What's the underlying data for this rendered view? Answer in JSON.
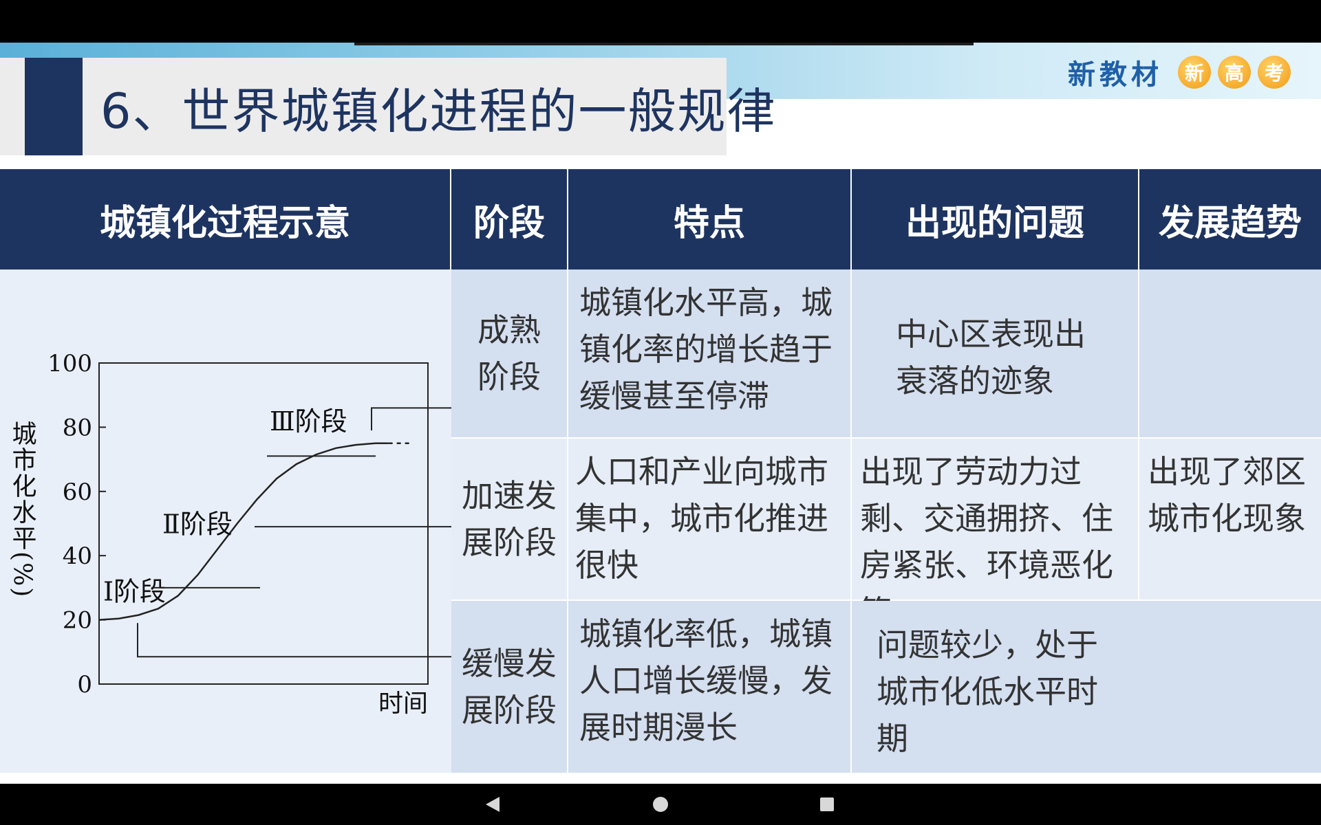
{
  "slide": {
    "title": "6、世界城镇化进程的一般规律",
    "brand_text": "新教材",
    "brand_circles": [
      "新",
      "高",
      "考"
    ]
  },
  "table": {
    "headers": [
      "城镇化过程示意",
      "阶段",
      "特点",
      "出现的问题",
      "发展趋势"
    ],
    "rows": [
      {
        "stage": "成熟阶段",
        "features": "城镇化水平高，城镇化率的增长趋于缓慢甚至停滞",
        "problems": "中心区表现出衰落的迹象",
        "trend": ""
      },
      {
        "stage": "加速发展阶段",
        "features": "人口和产业向城市集中，城市化推进很快",
        "problems": "出现了劳动力过剩、交通拥挤、住房紧张、环境恶化等",
        "trend": "出现了郊区城市化现象"
      },
      {
        "stage": "缓慢发展阶段",
        "features": "城镇化率低，城镇人口增长缓慢，发展时期漫长",
        "problems": "问题较少，处于城市化低水平时期",
        "trend": ""
      }
    ]
  },
  "chart_data": {
    "type": "line",
    "ylabel": "城市化水平(%)",
    "xlabel": "时间",
    "ylim": [
      0,
      100
    ],
    "yticks": [
      0,
      20,
      40,
      60,
      80,
      100
    ],
    "series": [
      {
        "x": [
          0,
          0.06,
          0.12,
          0.18,
          0.24,
          0.3,
          0.36,
          0.42,
          0.48,
          0.54,
          0.6,
          0.66,
          0.72,
          0.78,
          0.84,
          0.88
        ],
        "y": [
          20,
          20.4,
          21.5,
          23.5,
          27.5,
          34,
          42,
          50,
          57.5,
          64,
          68.5,
          71.5,
          73.5,
          74.5,
          75,
          75
        ]
      }
    ],
    "annotations": [
      "Ⅰ阶段",
      "Ⅱ阶段",
      "Ⅲ阶段"
    ]
  },
  "toolbar": [
    "prev-icon",
    "next-icon",
    "pen-icon",
    "screenshot-icon",
    "camera-icon",
    "more-icon"
  ],
  "navbar": [
    "back-icon",
    "home-icon",
    "recents-icon"
  ]
}
